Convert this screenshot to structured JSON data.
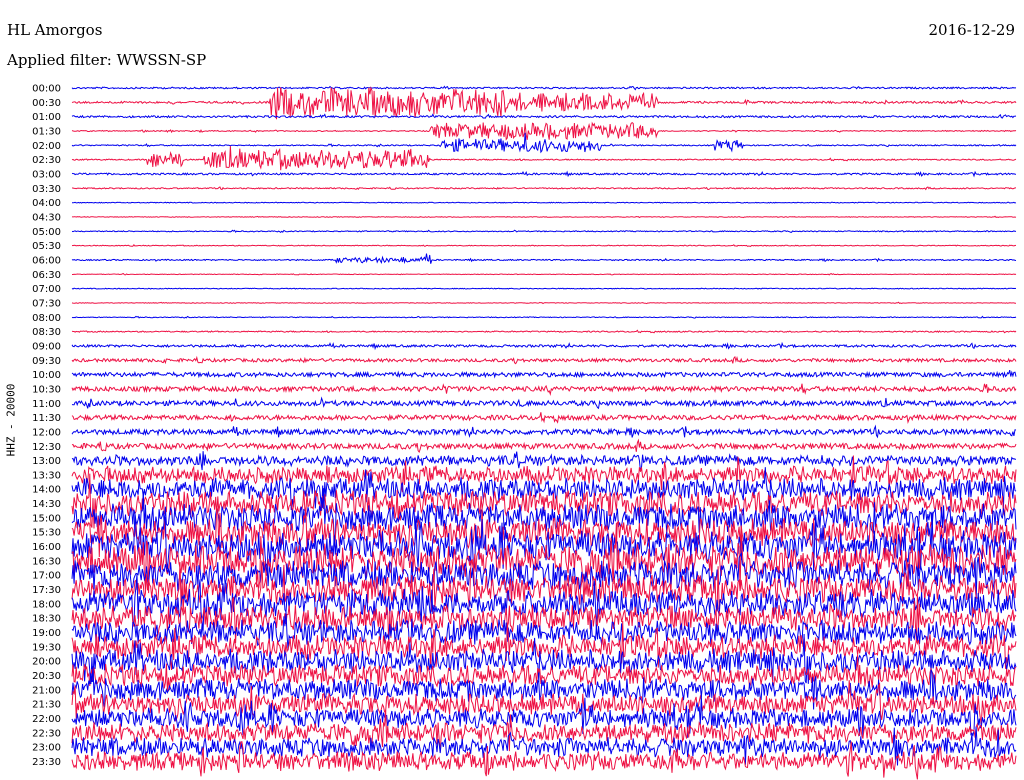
{
  "header": {
    "station": "HL Amorgos",
    "date": "2016-12-29",
    "filter": "Applied filter: WWSSN-SP",
    "channel": "HHZ - 20000"
  },
  "chart_data": {
    "type": "line",
    "title": "",
    "xlabel": "",
    "ylabel": "HHZ - 20000",
    "row_labels": [
      "00:00",
      "00:30",
      "01:00",
      "01:30",
      "02:00",
      "02:30",
      "03:00",
      "03:30",
      "04:00",
      "04:30",
      "05:00",
      "05:30",
      "06:00",
      "06:30",
      "07:00",
      "07:30",
      "08:00",
      "08:30",
      "09:00",
      "09:30",
      "10:00",
      "10:30",
      "11:00",
      "11:30",
      "12:00",
      "12:30",
      "13:00",
      "13:30",
      "14:00",
      "14:30",
      "15:00",
      "15:30",
      "16:00",
      "16:30",
      "17:00",
      "17:30",
      "18:00",
      "18:30",
      "19:00",
      "19:30",
      "20:00",
      "20:30",
      "21:00",
      "21:30",
      "22:00",
      "22:30",
      "23:00",
      "23:30"
    ],
    "trace_colors": [
      "#0000ee",
      "#ee1144"
    ],
    "relative_amplitude": [
      0.8,
      1.0,
      1.0,
      0.5,
      0.6,
      0.6,
      0.9,
      0.6,
      0.4,
      0.3,
      0.5,
      0.4,
      0.6,
      0.3,
      0.4,
      0.3,
      0.4,
      0.6,
      1.2,
      1.6,
      2.2,
      2.4,
      2.4,
      2.4,
      2.6,
      2.8,
      4.5,
      7.5,
      9.5,
      11,
      12,
      12,
      13,
      14,
      13,
      12,
      12,
      11,
      10.5,
      10,
      10,
      9.5,
      9.5,
      9,
      8.5,
      8.5,
      8.5,
      8.0
    ],
    "events": [
      {
        "row": 1,
        "start": 0.21,
        "end": 0.46,
        "amp": 16
      },
      {
        "row": 1,
        "start": 0.46,
        "end": 0.62,
        "amp": 10
      },
      {
        "row": 3,
        "start": 0.38,
        "end": 0.62,
        "amp": 9
      },
      {
        "row": 4,
        "start": 0.39,
        "end": 0.56,
        "amp": 7
      },
      {
        "row": 4,
        "start": 0.68,
        "end": 0.71,
        "amp": 6
      },
      {
        "row": 5,
        "start": 0.08,
        "end": 0.12,
        "amp": 9
      },
      {
        "row": 5,
        "start": 0.14,
        "end": 0.38,
        "amp": 11
      },
      {
        "row": 12,
        "start": 0.28,
        "end": 0.38,
        "amp": 3
      }
    ]
  }
}
